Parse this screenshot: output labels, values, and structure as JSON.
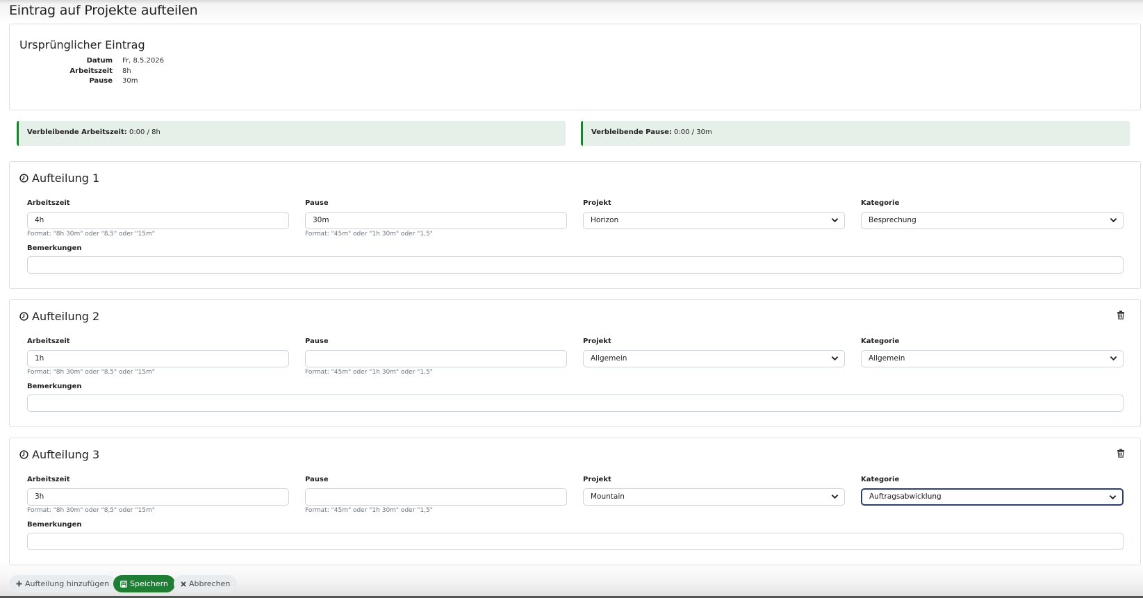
{
  "page": {
    "title": "Eintrag auf Projekte aufteilen"
  },
  "original": {
    "title": "Ursprünglicher Eintrag",
    "rows": [
      {
        "label": "Datum",
        "value": "Fr, 8.5.2026"
      },
      {
        "label": "Arbeitszeit",
        "value": "8h"
      },
      {
        "label": "Pause",
        "value": "30m"
      }
    ]
  },
  "remaining": {
    "work_label": "Verbleibende Arbeitszeit:",
    "work_value": "0:00 / 8h",
    "pause_label": "Verbleibende Pause:",
    "pause_value": "0:00 / 30m"
  },
  "labels": {
    "arbeitszeit": "Arbeitszeit",
    "pause": "Pause",
    "projekt": "Projekt",
    "kategorie": "Kategorie",
    "bemerkungen": "Bemerkungen",
    "hint_arbeitszeit": "Format: \"8h 30m\" oder \"8,5\" oder \"15m\"",
    "hint_pause": "Format: \"45m\" oder \"1h 30m\" oder \"1,5\""
  },
  "splits": [
    {
      "title": "Aufteilung 1",
      "arbeitszeit": "4h",
      "pause": "30m",
      "projekt": "Horizon",
      "kategorie": "Besprechung",
      "bemerkungen": ""
    },
    {
      "title": "Aufteilung 2",
      "arbeitszeit": "1h",
      "pause": "",
      "projekt": "Allgemein",
      "kategorie": "Allgemein",
      "bemerkungen": ""
    },
    {
      "title": "Aufteilung 3",
      "arbeitszeit": "3h",
      "pause": "",
      "projekt": "Mountain",
      "kategorie": "Auftragsabwicklung",
      "bemerkungen": ""
    }
  ],
  "buttons": {
    "add": "Aufteilung hinzufügen",
    "save": "Speichern",
    "cancel": "Abbrechen"
  },
  "colors": {
    "success": "#1e7e34",
    "alert_bg": "#e5f0e8"
  },
  "icons": {
    "split": "clock-icon",
    "delete": "trash-icon",
    "add": "plus-icon",
    "save": "save-icon",
    "cancel": "x-icon"
  }
}
